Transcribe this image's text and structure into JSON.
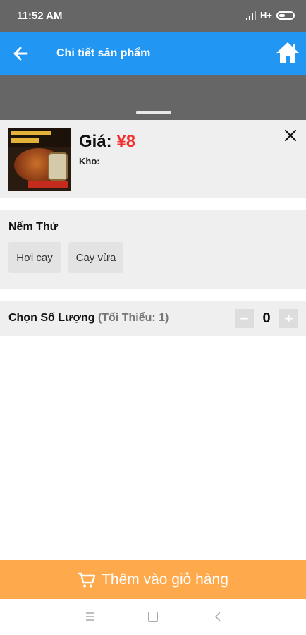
{
  "status_bar": {
    "time": "11:52 AM",
    "network": "H+"
  },
  "app_bar": {
    "title": "Chi tiết sản phẩm"
  },
  "product": {
    "price_label": "Giá: ",
    "price_value": "¥8",
    "stock_label": "Kho: ",
    "stock_value": "---"
  },
  "flavor": {
    "title": "Nếm Thử",
    "options": [
      "Hơi cay",
      "Cay vừa"
    ]
  },
  "quantity": {
    "title": "Chọn Số Lượng ",
    "minimum": "(Tối Thiểu: 1)",
    "value": "0",
    "decrement": "−",
    "increment": "+"
  },
  "add_to_cart": {
    "label": "Thêm vào giỏ hàng"
  },
  "colors": {
    "app_bar": "#2196f3",
    "price": "#f03030",
    "add_to_cart": "#ffa94d",
    "overlay": "#666666"
  }
}
